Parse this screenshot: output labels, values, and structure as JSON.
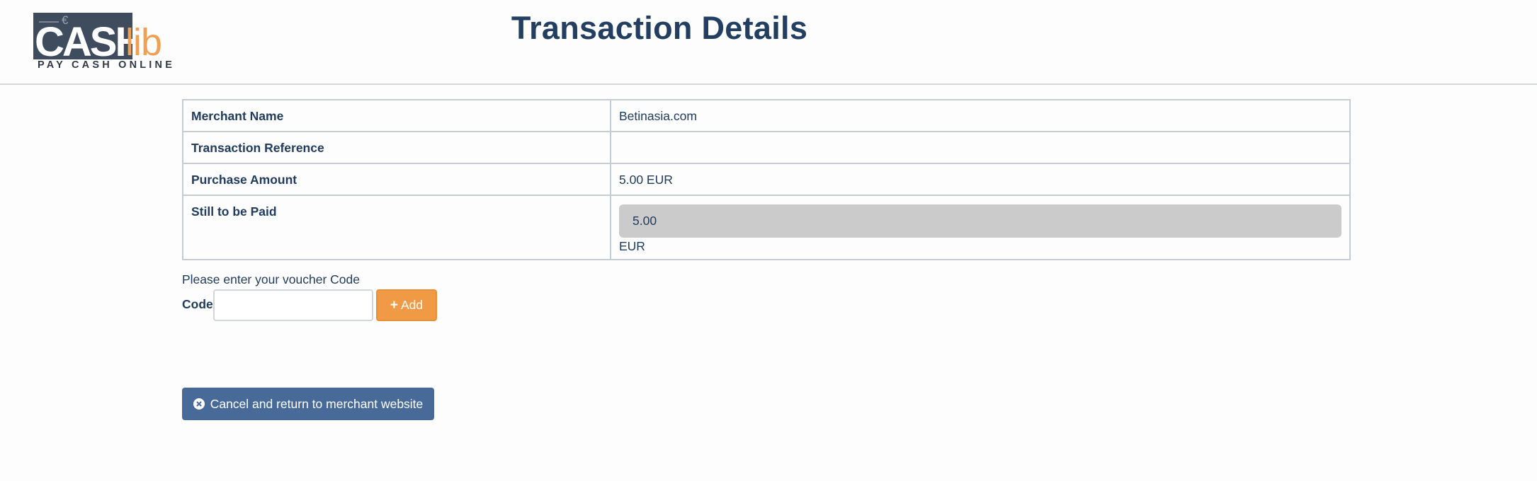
{
  "logo": {
    "brand_primary": "CASH",
    "brand_secondary": "lib",
    "tagline": "PAY CASH ONLINE",
    "euro_symbol": "€"
  },
  "page_title": "Transaction Details",
  "details": [
    {
      "label": "Merchant Name",
      "value": "Betinasia.com"
    },
    {
      "label": "Transaction Reference",
      "value": ""
    },
    {
      "label": "Purchase Amount",
      "value": "5.00 EUR"
    }
  ],
  "still_to_pay": {
    "label": "Still to be Paid",
    "amount": "5.00",
    "currency": "EUR"
  },
  "voucher": {
    "prompt": "Please enter your voucher Code",
    "code_label": "Code",
    "code_value": "",
    "add_label": "Add",
    "add_icon": "plus-icon"
  },
  "cancel": {
    "label": "Cancel and return to merchant website",
    "icon": "close-circle-icon"
  },
  "colors": {
    "title": "#223f61",
    "accent_orange": "#f09a46",
    "button_blue": "#486a98",
    "amount_box": "#cbcbcb"
  }
}
